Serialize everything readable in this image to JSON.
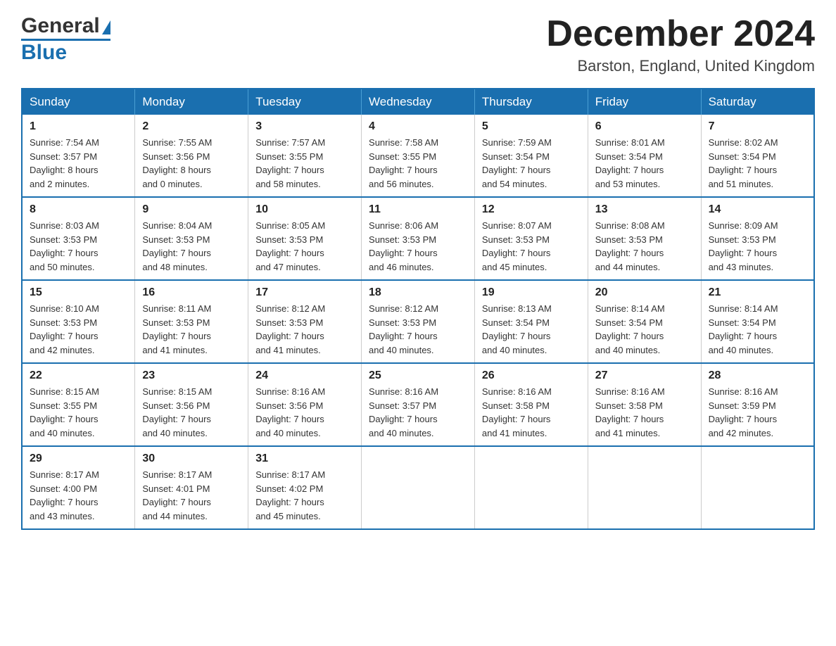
{
  "header": {
    "logo_general": "General",
    "logo_blue": "Blue",
    "title": "December 2024",
    "location": "Barston, England, United Kingdom"
  },
  "days_of_week": [
    "Sunday",
    "Monday",
    "Tuesday",
    "Wednesday",
    "Thursday",
    "Friday",
    "Saturday"
  ],
  "weeks": [
    [
      {
        "day": "1",
        "sunrise": "7:54 AM",
        "sunset": "3:57 PM",
        "daylight": "8 hours and 2 minutes."
      },
      {
        "day": "2",
        "sunrise": "7:55 AM",
        "sunset": "3:56 PM",
        "daylight": "8 hours and 0 minutes."
      },
      {
        "day": "3",
        "sunrise": "7:57 AM",
        "sunset": "3:55 PM",
        "daylight": "7 hours and 58 minutes."
      },
      {
        "day": "4",
        "sunrise": "7:58 AM",
        "sunset": "3:55 PM",
        "daylight": "7 hours and 56 minutes."
      },
      {
        "day": "5",
        "sunrise": "7:59 AM",
        "sunset": "3:54 PM",
        "daylight": "7 hours and 54 minutes."
      },
      {
        "day": "6",
        "sunrise": "8:01 AM",
        "sunset": "3:54 PM",
        "daylight": "7 hours and 53 minutes."
      },
      {
        "day": "7",
        "sunrise": "8:02 AM",
        "sunset": "3:54 PM",
        "daylight": "7 hours and 51 minutes."
      }
    ],
    [
      {
        "day": "8",
        "sunrise": "8:03 AM",
        "sunset": "3:53 PM",
        "daylight": "7 hours and 50 minutes."
      },
      {
        "day": "9",
        "sunrise": "8:04 AM",
        "sunset": "3:53 PM",
        "daylight": "7 hours and 48 minutes."
      },
      {
        "day": "10",
        "sunrise": "8:05 AM",
        "sunset": "3:53 PM",
        "daylight": "7 hours and 47 minutes."
      },
      {
        "day": "11",
        "sunrise": "8:06 AM",
        "sunset": "3:53 PM",
        "daylight": "7 hours and 46 minutes."
      },
      {
        "day": "12",
        "sunrise": "8:07 AM",
        "sunset": "3:53 PM",
        "daylight": "7 hours and 45 minutes."
      },
      {
        "day": "13",
        "sunrise": "8:08 AM",
        "sunset": "3:53 PM",
        "daylight": "7 hours and 44 minutes."
      },
      {
        "day": "14",
        "sunrise": "8:09 AM",
        "sunset": "3:53 PM",
        "daylight": "7 hours and 43 minutes."
      }
    ],
    [
      {
        "day": "15",
        "sunrise": "8:10 AM",
        "sunset": "3:53 PM",
        "daylight": "7 hours and 42 minutes."
      },
      {
        "day": "16",
        "sunrise": "8:11 AM",
        "sunset": "3:53 PM",
        "daylight": "7 hours and 41 minutes."
      },
      {
        "day": "17",
        "sunrise": "8:12 AM",
        "sunset": "3:53 PM",
        "daylight": "7 hours and 41 minutes."
      },
      {
        "day": "18",
        "sunrise": "8:12 AM",
        "sunset": "3:53 PM",
        "daylight": "7 hours and 40 minutes."
      },
      {
        "day": "19",
        "sunrise": "8:13 AM",
        "sunset": "3:54 PM",
        "daylight": "7 hours and 40 minutes."
      },
      {
        "day": "20",
        "sunrise": "8:14 AM",
        "sunset": "3:54 PM",
        "daylight": "7 hours and 40 minutes."
      },
      {
        "day": "21",
        "sunrise": "8:14 AM",
        "sunset": "3:54 PM",
        "daylight": "7 hours and 40 minutes."
      }
    ],
    [
      {
        "day": "22",
        "sunrise": "8:15 AM",
        "sunset": "3:55 PM",
        "daylight": "7 hours and 40 minutes."
      },
      {
        "day": "23",
        "sunrise": "8:15 AM",
        "sunset": "3:56 PM",
        "daylight": "7 hours and 40 minutes."
      },
      {
        "day": "24",
        "sunrise": "8:16 AM",
        "sunset": "3:56 PM",
        "daylight": "7 hours and 40 minutes."
      },
      {
        "day": "25",
        "sunrise": "8:16 AM",
        "sunset": "3:57 PM",
        "daylight": "7 hours and 40 minutes."
      },
      {
        "day": "26",
        "sunrise": "8:16 AM",
        "sunset": "3:58 PM",
        "daylight": "7 hours and 41 minutes."
      },
      {
        "day": "27",
        "sunrise": "8:16 AM",
        "sunset": "3:58 PM",
        "daylight": "7 hours and 41 minutes."
      },
      {
        "day": "28",
        "sunrise": "8:16 AM",
        "sunset": "3:59 PM",
        "daylight": "7 hours and 42 minutes."
      }
    ],
    [
      {
        "day": "29",
        "sunrise": "8:17 AM",
        "sunset": "4:00 PM",
        "daylight": "7 hours and 43 minutes."
      },
      {
        "day": "30",
        "sunrise": "8:17 AM",
        "sunset": "4:01 PM",
        "daylight": "7 hours and 44 minutes."
      },
      {
        "day": "31",
        "sunrise": "8:17 AM",
        "sunset": "4:02 PM",
        "daylight": "7 hours and 45 minutes."
      },
      null,
      null,
      null,
      null
    ]
  ],
  "labels": {
    "sunrise": "Sunrise:",
    "sunset": "Sunset:",
    "daylight": "Daylight:"
  }
}
